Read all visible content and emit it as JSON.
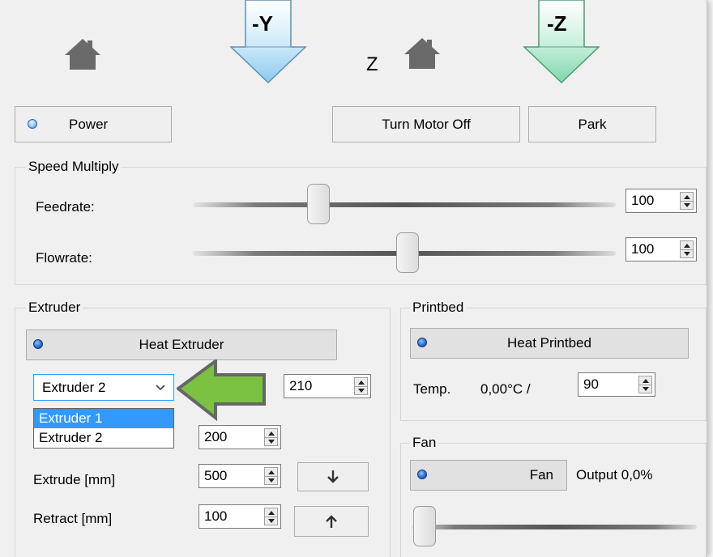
{
  "header": {
    "y_arrow_label": "-Y",
    "z_arrow_label": "-Z",
    "z_label": "Z"
  },
  "buttons": {
    "power": "Power",
    "turn_motor_off": "Turn Motor Off",
    "park": "Park"
  },
  "speed_multiply": {
    "title": "Speed Multiply",
    "feedrate_label": "Feedrate:",
    "feedrate_value": "100",
    "feedrate_level": 0.27,
    "flowrate_label": "Flowrate:",
    "flowrate_value": "100",
    "flowrate_level": 0.48
  },
  "extruder": {
    "title": "Extruder",
    "heat_button": "Heat Extruder",
    "selected": "Extruder 2",
    "options": [
      "Extruder 1",
      "Extruder 2"
    ],
    "highlighted_option": "Extruder 1",
    "target_temp": "210",
    "second_temp": "200",
    "extrude_label": "Extrude [mm]",
    "extrude_value": "500",
    "retract_label": "Retract [mm]",
    "retract_value": "100"
  },
  "printbed": {
    "title": "Printbed",
    "heat_button": "Heat Printbed",
    "temp_label": "Temp.",
    "temp_reading": "0,00°C /",
    "target_value": "90"
  },
  "fan": {
    "title": "Fan",
    "button": "Fan",
    "output_text": "Output 0,0%",
    "level": 0.0
  },
  "colors": {
    "y_arrow": "#a9d6f3",
    "z_arrow": "#9ee0c0",
    "callout_arrow": "#7cc242",
    "selection": "#3399ff"
  }
}
